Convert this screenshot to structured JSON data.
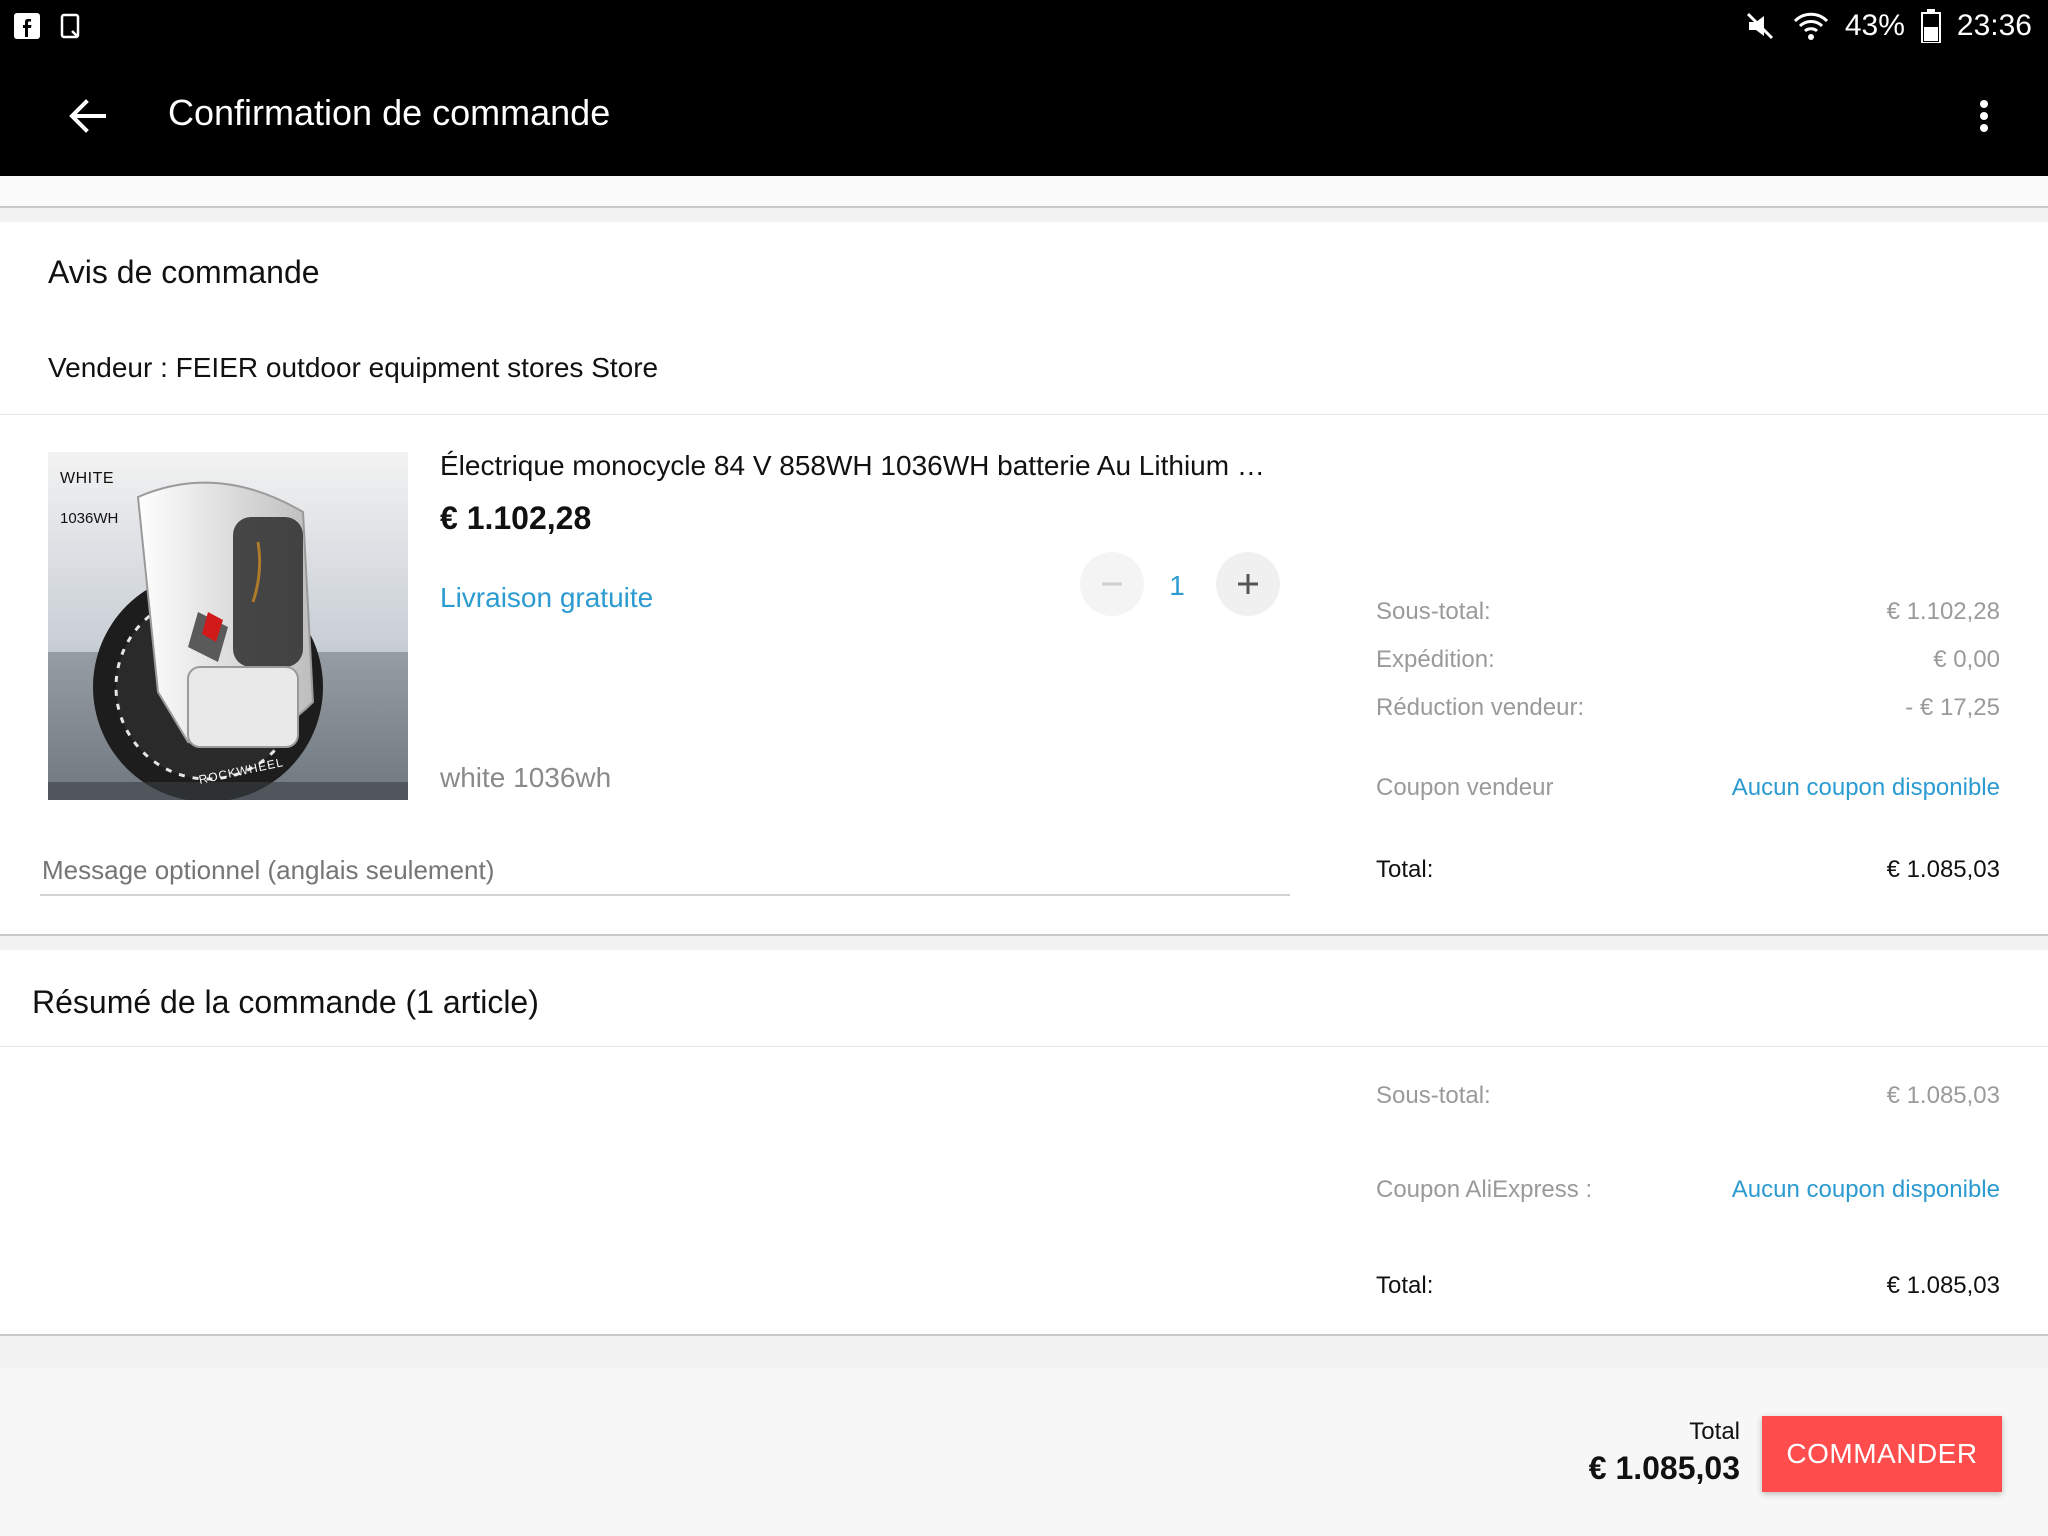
{
  "status": {
    "battery": "43%",
    "time": "23:36"
  },
  "app_bar": {
    "title": "Confirmation de commande"
  },
  "order_notice": {
    "heading": "Avis de commande",
    "seller_line": "Vendeur : FEIER outdoor equipment stores Store",
    "product": {
      "title": "Électrique monocycle 84 V 858WH 1036WH batterie Au Lithium R...",
      "price": "€ 1.102,28",
      "shipping": "Livraison gratuite",
      "quantity": "1",
      "variant": "white 1036wh",
      "image_label_color": "WHITE",
      "image_label_capacity": "1036WH",
      "image_brand": "ROCKWHEEL"
    },
    "message_placeholder": "Message optionnel (anglais seulement)",
    "summary": {
      "subtotal_label": "Sous-total:",
      "subtotal_value": "€ 1.102,28",
      "shipping_label": "Expédition:",
      "shipping_value": "€ 0,00",
      "discount_label": "Réduction vendeur:",
      "discount_value": "- € 17,25",
      "coupon_label": "Coupon vendeur",
      "coupon_value": "Aucun coupon disponible",
      "total_label": "Total:",
      "total_value": "€ 1.085,03"
    }
  },
  "order_summary": {
    "heading": "Résumé de la commande (1 article)",
    "subtotal_label": "Sous-total:",
    "subtotal_value": "€ 1.085,03",
    "coupon_label": "Coupon AliExpress :",
    "coupon_value": "Aucun coupon disponible",
    "total_label": "Total:",
    "total_value": "€ 1.085,03"
  },
  "footer": {
    "total_label": "Total",
    "total_value": "€ 1.085,03",
    "cta_label": "COMMANDER"
  },
  "colors": {
    "accent_blue": "#2b9bd1",
    "cta_red": "#ff4c4c",
    "app_bar": "#000000"
  }
}
